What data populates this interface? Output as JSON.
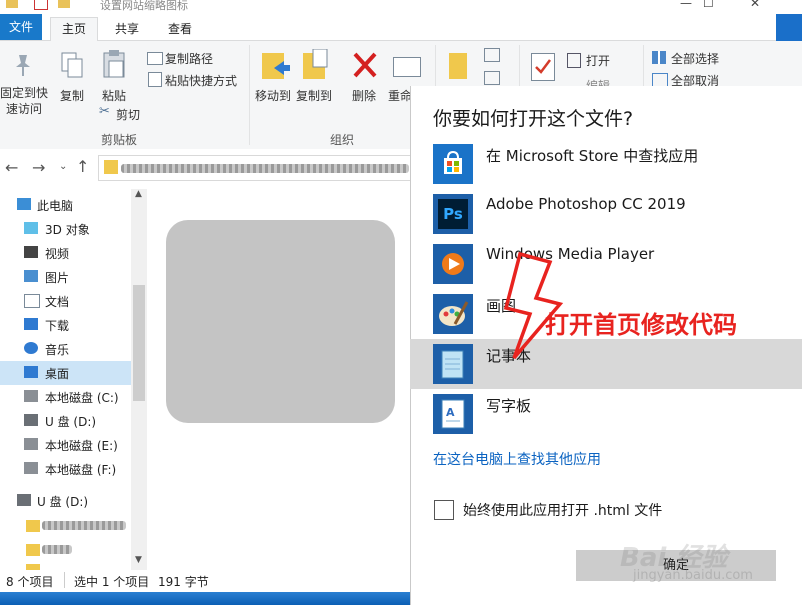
{
  "window": {
    "title": "设置网站缩略图标",
    "min": "—",
    "max": "☐",
    "close": "✕"
  },
  "tabs": {
    "file": "文件",
    "home": "主页",
    "share": "共享",
    "view": "查看"
  },
  "ribbon": {
    "pin": "固定到快\n速访问",
    "copy": "复制",
    "paste": "粘贴",
    "copy_path": "复制路径",
    "paste_shortcut": "粘贴快捷方式",
    "cut": "剪切",
    "clipboard_group": "剪贴板",
    "move_to": "移动到",
    "copy_to": "复制到",
    "delete": "删除",
    "rename": "重命",
    "organize_group": "组织",
    "open": "打开",
    "edit": "编辑",
    "select_all": "全部选择",
    "select_none": "全部取消"
  },
  "nav": {
    "items": [
      {
        "label": "此电脑",
        "icon": "pc-icon"
      },
      {
        "label": "3D 对象",
        "icon": "3d-objects-icon"
      },
      {
        "label": "视频",
        "icon": "video-icon"
      },
      {
        "label": "图片",
        "icon": "pictures-icon"
      },
      {
        "label": "文档",
        "icon": "documents-icon"
      },
      {
        "label": "下载",
        "icon": "download-icon"
      },
      {
        "label": "音乐",
        "icon": "music-icon"
      },
      {
        "label": "桌面",
        "icon": "desktop-icon"
      },
      {
        "label": "本地磁盘 (C:)",
        "icon": "drive-icon"
      },
      {
        "label": "U 盘 (D:)",
        "icon": "usb-drive-icon"
      },
      {
        "label": "本地磁盘 (E:)",
        "icon": "drive-icon"
      },
      {
        "label": "本地磁盘 (F:)",
        "icon": "drive-icon"
      },
      {
        "label": "U 盘 (D:)",
        "icon": "usb-drive-icon"
      }
    ]
  },
  "status": {
    "count": "8 个项目",
    "selected": "选中 1 个项目",
    "size": "191 字节"
  },
  "dialog": {
    "title": "你要如何打开这个文件?",
    "apps": [
      {
        "name": "在 Microsoft Store 中查找应用",
        "icon": "store-icon"
      },
      {
        "name": "Adobe Photoshop CC 2019",
        "icon": "photoshop-icon"
      },
      {
        "name": "Windows Media Player",
        "icon": "media-player-icon"
      },
      {
        "name": "画图",
        "icon": "paint-icon"
      },
      {
        "name": "记事本",
        "icon": "notepad-icon"
      },
      {
        "name": "写字板",
        "icon": "wordpad-icon"
      }
    ],
    "more_link": "在这台电脑上查找其他应用",
    "always_label": "始终使用此应用打开 .html 文件",
    "ok": "确定"
  },
  "annotation": {
    "text": "打开首页修改代码",
    "color": "#e8231f"
  },
  "watermark": {
    "line1": "Bai 经验",
    "line2": "jingyan.baidu.com"
  },
  "colors": {
    "accent": "#1979ca",
    "link": "#0b63c1",
    "highlight": "#d8d8d8"
  }
}
